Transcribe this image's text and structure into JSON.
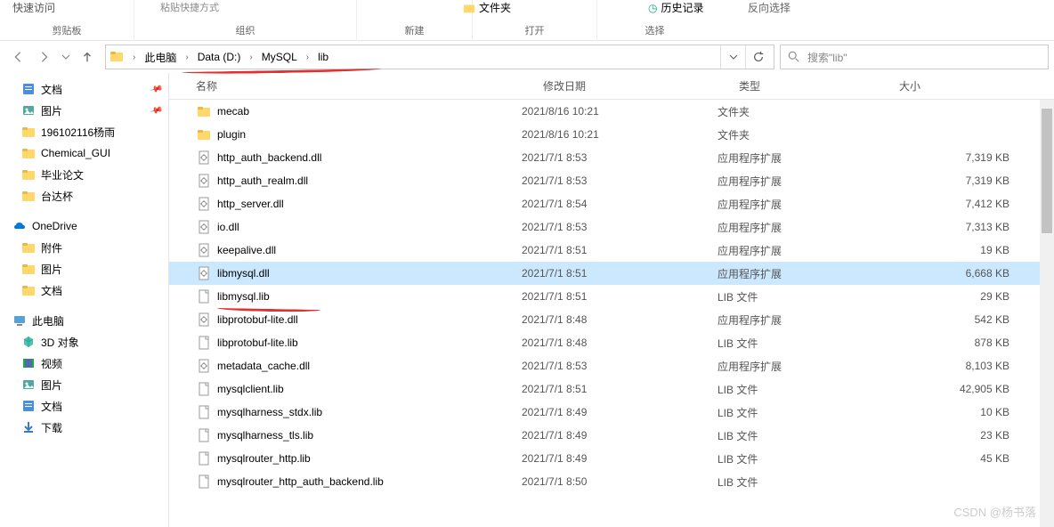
{
  "quick_access_label": "快速访问",
  "ribbon": {
    "clipboard_label": "剪贴板",
    "organize_label": "组织",
    "folder_label": "文件夹",
    "new_label": "新建",
    "open_label": "打开",
    "history_label": "历史记录",
    "select_label": "选择",
    "invert_label": "反向选择",
    "shortcut_label": "粘贴快捷方式"
  },
  "breadcrumb": {
    "this_pc": "此电脑",
    "drive": "Data (D:)",
    "folder1": "MySQL",
    "folder2": "lib"
  },
  "search": {
    "placeholder": "搜索\"lib\""
  },
  "sidebar": {
    "items": [
      {
        "label": "文档",
        "icon": "doc",
        "pin": true
      },
      {
        "label": "图片",
        "icon": "img",
        "pin": true
      },
      {
        "label": "196102116杨雨",
        "icon": "folder",
        "pin": false
      },
      {
        "label": "Chemical_GUI",
        "icon": "folder",
        "pin": false
      },
      {
        "label": "毕业论文",
        "icon": "folder",
        "pin": false
      },
      {
        "label": "台达杯",
        "icon": "folder",
        "pin": false
      }
    ],
    "onedrive": "OneDrive",
    "od_items": [
      {
        "label": "附件",
        "icon": "folder"
      },
      {
        "label": "图片",
        "icon": "folder"
      },
      {
        "label": "文档",
        "icon": "folder"
      }
    ],
    "this_pc": "此电脑",
    "pc_items": [
      {
        "label": "3D 对象",
        "icon": "3d"
      },
      {
        "label": "视频",
        "icon": "video"
      },
      {
        "label": "图片",
        "icon": "img"
      },
      {
        "label": "文档",
        "icon": "doc"
      },
      {
        "label": "下载",
        "icon": "dl"
      }
    ]
  },
  "columns": {
    "name": "名称",
    "date": "修改日期",
    "type": "类型",
    "size": "大小"
  },
  "files": [
    {
      "name": "mecab",
      "date": "2021/8/16 10:21",
      "type": "文件夹",
      "size": "",
      "icon": "folder",
      "selected": false
    },
    {
      "name": "plugin",
      "date": "2021/8/16 10:21",
      "type": "文件夹",
      "size": "",
      "icon": "folder",
      "selected": false
    },
    {
      "name": "http_auth_backend.dll",
      "date": "2021/7/1 8:53",
      "type": "应用程序扩展",
      "size": "7,319 KB",
      "icon": "dll",
      "selected": false
    },
    {
      "name": "http_auth_realm.dll",
      "date": "2021/7/1 8:53",
      "type": "应用程序扩展",
      "size": "7,319 KB",
      "icon": "dll",
      "selected": false
    },
    {
      "name": "http_server.dll",
      "date": "2021/7/1 8:54",
      "type": "应用程序扩展",
      "size": "7,412 KB",
      "icon": "dll",
      "selected": false
    },
    {
      "name": "io.dll",
      "date": "2021/7/1 8:53",
      "type": "应用程序扩展",
      "size": "7,313 KB",
      "icon": "dll",
      "selected": false
    },
    {
      "name": "keepalive.dll",
      "date": "2021/7/1 8:51",
      "type": "应用程序扩展",
      "size": "19 KB",
      "icon": "dll",
      "selected": false
    },
    {
      "name": "libmysql.dll",
      "date": "2021/7/1 8:51",
      "type": "应用程序扩展",
      "size": "6,668 KB",
      "icon": "dll",
      "selected": true
    },
    {
      "name": "libmysql.lib",
      "date": "2021/7/1 8:51",
      "type": "LIB 文件",
      "size": "29 KB",
      "icon": "lib",
      "selected": false
    },
    {
      "name": "libprotobuf-lite.dll",
      "date": "2021/7/1 8:48",
      "type": "应用程序扩展",
      "size": "542 KB",
      "icon": "dll",
      "selected": false
    },
    {
      "name": "libprotobuf-lite.lib",
      "date": "2021/7/1 8:48",
      "type": "LIB 文件",
      "size": "878 KB",
      "icon": "lib",
      "selected": false
    },
    {
      "name": "metadata_cache.dll",
      "date": "2021/7/1 8:53",
      "type": "应用程序扩展",
      "size": "8,103 KB",
      "icon": "dll",
      "selected": false
    },
    {
      "name": "mysqlclient.lib",
      "date": "2021/7/1 8:51",
      "type": "LIB 文件",
      "size": "42,905 KB",
      "icon": "lib",
      "selected": false
    },
    {
      "name": "mysqlharness_stdx.lib",
      "date": "2021/7/1 8:49",
      "type": "LIB 文件",
      "size": "10 KB",
      "icon": "lib",
      "selected": false
    },
    {
      "name": "mysqlharness_tls.lib",
      "date": "2021/7/1 8:49",
      "type": "LIB 文件",
      "size": "23 KB",
      "icon": "lib",
      "selected": false
    },
    {
      "name": "mysqlrouter_http.lib",
      "date": "2021/7/1 8:49",
      "type": "LIB 文件",
      "size": "45 KB",
      "icon": "lib",
      "selected": false
    },
    {
      "name": "mysqlrouter_http_auth_backend.lib",
      "date": "2021/7/1 8:50",
      "type": "LIB 文件",
      "size": "",
      "icon": "lib",
      "selected": false
    }
  ],
  "watermark": "CSDN @杨书落"
}
